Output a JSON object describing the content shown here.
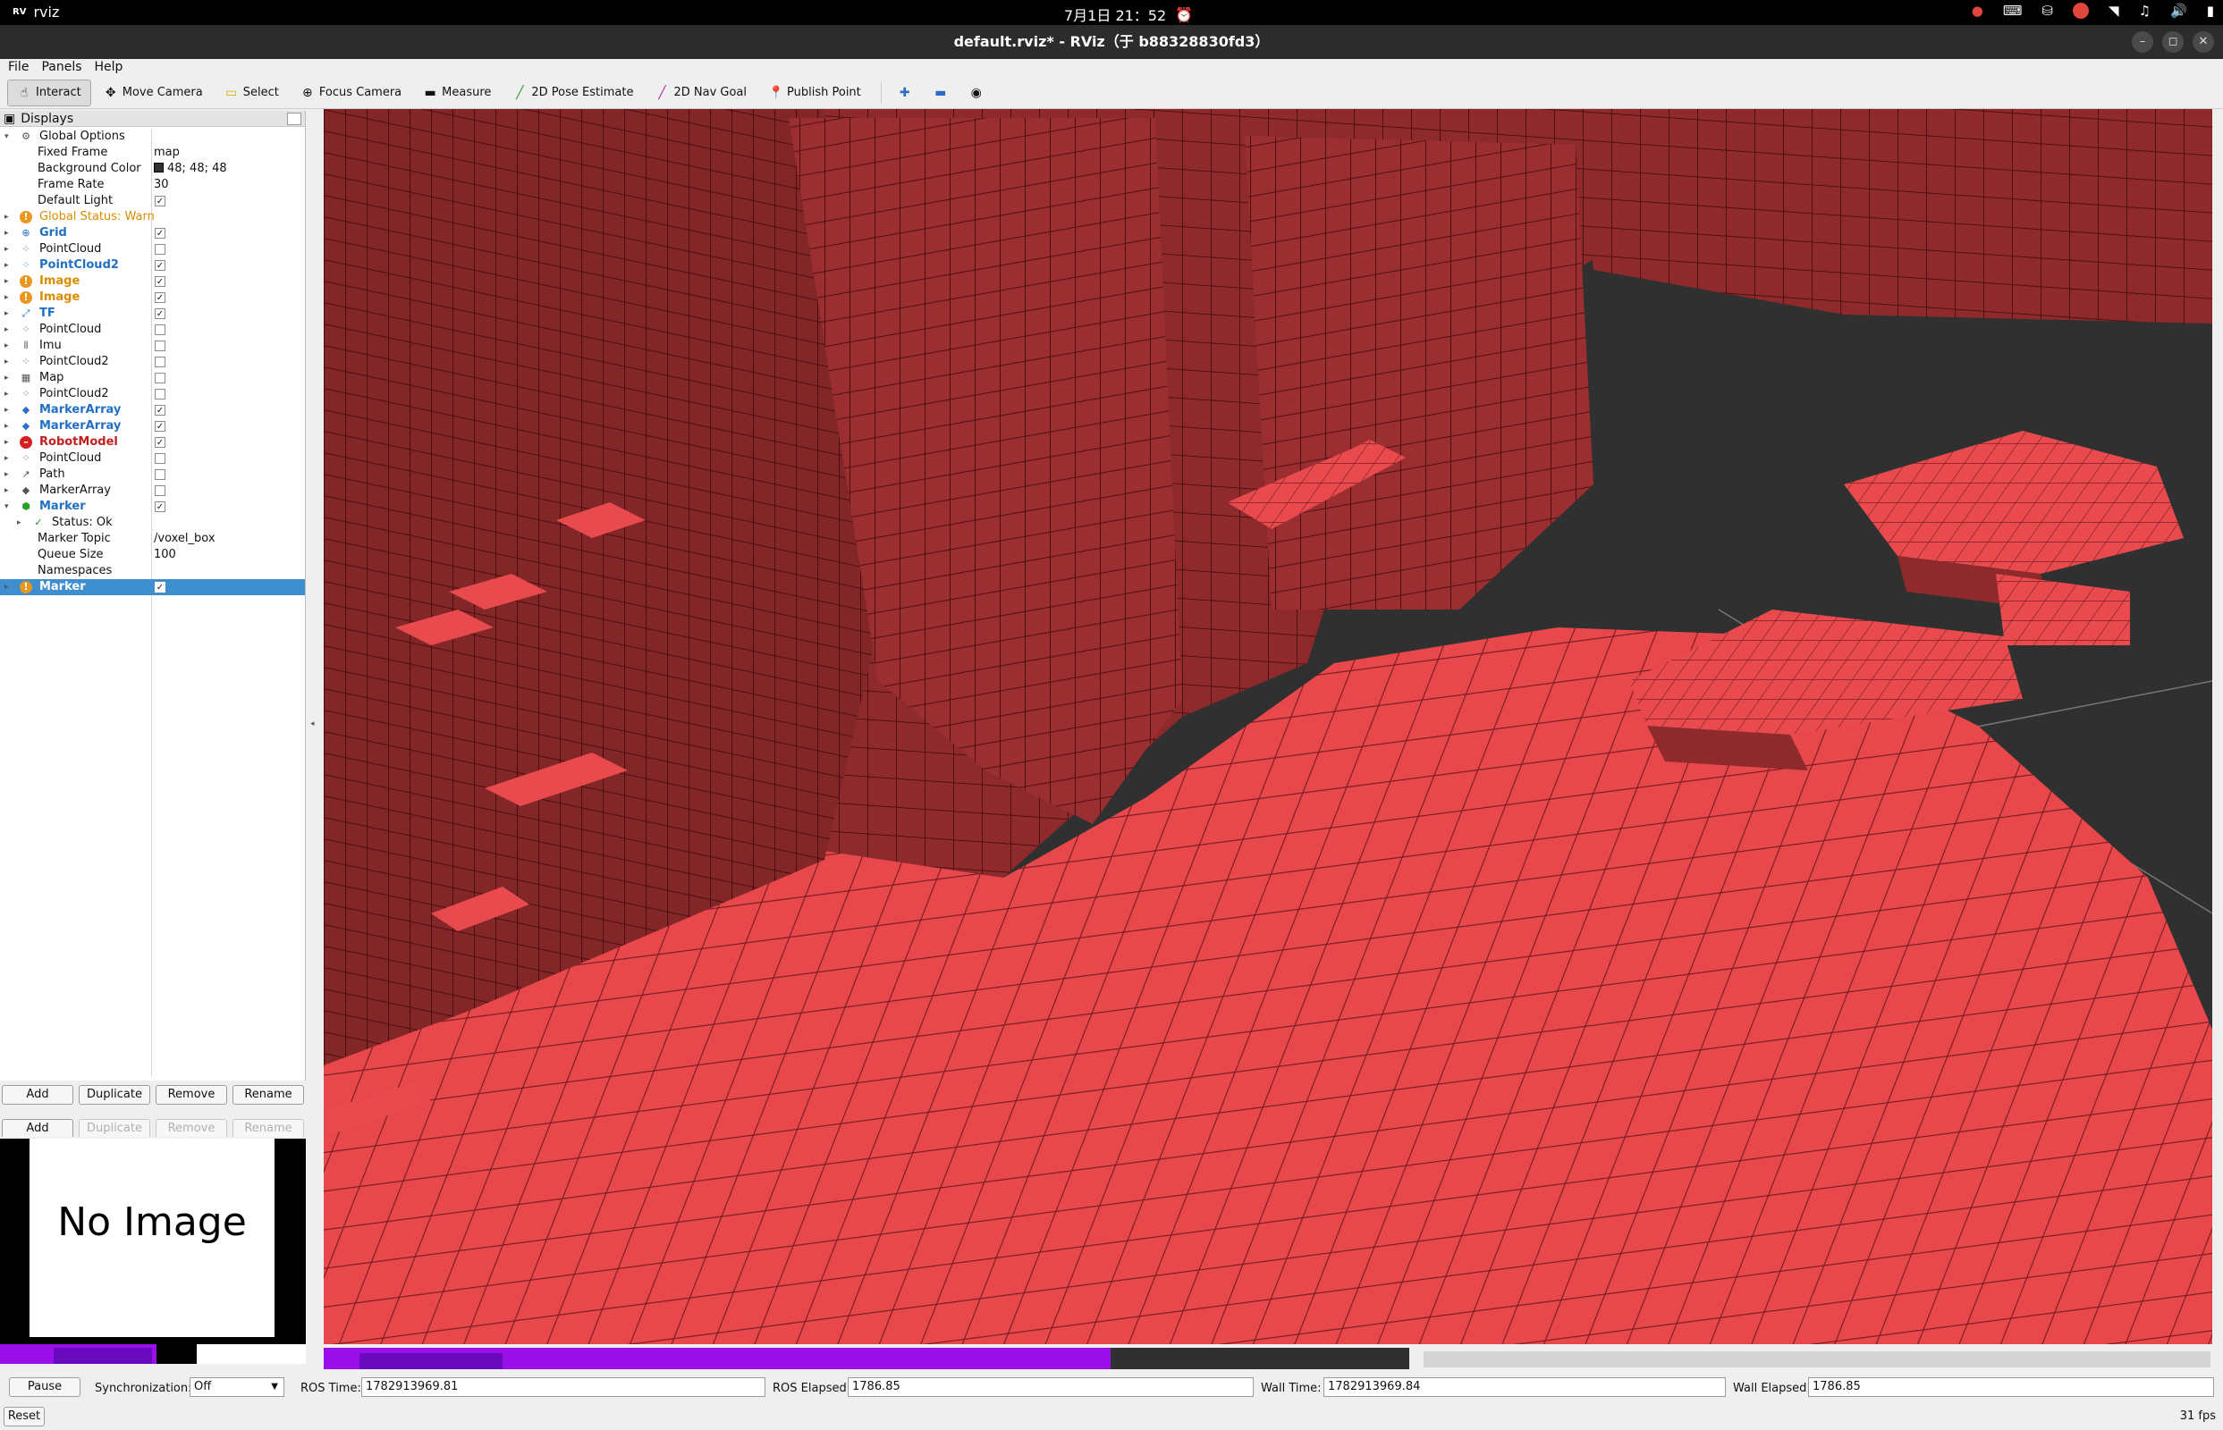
{
  "topbar": {
    "app_name": "rviz",
    "app_badge": "RV",
    "datetime": "7月1日  21：52",
    "tray_icons": [
      "record-icon",
      "keyboard-icon",
      "network-icon",
      "shield-icon",
      "wifi-icon",
      "mic-icon",
      "volume-icon",
      "battery-icon"
    ]
  },
  "window": {
    "title": "default.rviz* - RViz（于 b88328830fd3）"
  },
  "menu": [
    "File",
    "Panels",
    "Help"
  ],
  "toolbar": {
    "tools": [
      {
        "label": "Interact",
        "icon": "hand-icon",
        "active": true
      },
      {
        "label": "Move Camera",
        "icon": "move-camera-icon"
      },
      {
        "label": "Select",
        "icon": "select-icon"
      },
      {
        "label": "Focus Camera",
        "icon": "focus-camera-icon"
      },
      {
        "label": "Measure",
        "icon": "ruler-icon"
      },
      {
        "label": "2D Pose Estimate",
        "icon": "pose-arrow-icon"
      },
      {
        "label": "2D Nav Goal",
        "icon": "nav-goal-icon"
      },
      {
        "label": "Publish Point",
        "icon": "map-pin-icon"
      }
    ]
  },
  "displays": {
    "title": "Displays",
    "rows": [
      {
        "indent": 0,
        "arrow": "▾",
        "icon": "⚙",
        "name": "Global Options",
        "style": ""
      },
      {
        "indent": 1,
        "name": "Fixed Frame",
        "value": "map"
      },
      {
        "indent": 1,
        "name": "Background Color",
        "value": "48; 48; 48",
        "swatch": true
      },
      {
        "indent": 1,
        "name": "Frame Rate",
        "value": "30"
      },
      {
        "indent": 1,
        "name": "Default Light",
        "check": true
      },
      {
        "indent": 0,
        "arrow": "▸",
        "icon": "!",
        "iconclass": "warn-ico",
        "name": "Global Status: Warn",
        "style": "orange-plain"
      },
      {
        "indent": 0,
        "arrow": "▸",
        "icon": "⊕",
        "name": "Grid",
        "style": "blue",
        "check": true
      },
      {
        "indent": 0,
        "arrow": "▸",
        "icon": "⁘",
        "name": "PointCloud",
        "style": "",
        "check": false
      },
      {
        "indent": 0,
        "arrow": "▸",
        "icon": "⁘",
        "name": "PointCloud2",
        "style": "blue",
        "check": true
      },
      {
        "indent": 0,
        "arrow": "▸",
        "icon": "!",
        "iconclass": "warn-ico",
        "name": "Image",
        "style": "orange",
        "check": true
      },
      {
        "indent": 0,
        "arrow": "▸",
        "icon": "!",
        "iconclass": "warn-ico",
        "name": "Image",
        "style": "orange",
        "check": true
      },
      {
        "indent": 0,
        "arrow": "▸",
        "icon": "⤢",
        "name": "TF",
        "style": "blue",
        "check": true
      },
      {
        "indent": 0,
        "arrow": "▸",
        "icon": "⁘",
        "name": "PointCloud",
        "style": "",
        "check": false
      },
      {
        "indent": 0,
        "arrow": "▸",
        "icon": "⫴",
        "name": "Imu",
        "style": "",
        "check": false
      },
      {
        "indent": 0,
        "arrow": "▸",
        "icon": "⁘",
        "name": "PointCloud2",
        "style": "",
        "check": false
      },
      {
        "indent": 0,
        "arrow": "▸",
        "icon": "▦",
        "name": "Map",
        "style": "",
        "check": false
      },
      {
        "indent": 0,
        "arrow": "▸",
        "icon": "⁘",
        "name": "PointCloud2",
        "style": "",
        "check": false
      },
      {
        "indent": 0,
        "arrow": "▸",
        "icon": "◆",
        "name": "MarkerArray",
        "style": "blue",
        "check": true
      },
      {
        "indent": 0,
        "arrow": "▸",
        "icon": "◆",
        "name": "MarkerArray",
        "style": "blue",
        "check": true
      },
      {
        "indent": 0,
        "arrow": "▸",
        "icon": "–",
        "iconclass": "err-ico",
        "name": "RobotModel",
        "style": "red",
        "check": true
      },
      {
        "indent": 0,
        "arrow": "▸",
        "icon": "⁘",
        "name": "PointCloud",
        "style": "",
        "check": false
      },
      {
        "indent": 0,
        "arrow": "▸",
        "icon": "↗",
        "name": "Path",
        "style": "",
        "check": false
      },
      {
        "indent": 0,
        "arrow": "▸",
        "icon": "◆",
        "name": "MarkerArray",
        "style": "",
        "check": false
      },
      {
        "indent": 0,
        "arrow": "▾",
        "icon": "⬢",
        "name": "Marker",
        "style": "blue",
        "check": true
      },
      {
        "indent": 1,
        "arrow": "▸",
        "icon": "✓",
        "name": "Status: Ok",
        "style": "sub"
      },
      {
        "indent": 1,
        "name": "Marker Topic",
        "value": "/voxel_box"
      },
      {
        "indent": 1,
        "name": "Queue Size",
        "value": "100"
      },
      {
        "indent": 1,
        "name": "Namespaces",
        "value": ""
      },
      {
        "indent": 0,
        "arrow": "▸",
        "icon": "!",
        "iconclass": "warn-ico",
        "name": "Marker",
        "style": "selected",
        "check": true
      }
    ],
    "buttons": [
      "Add",
      "Duplicate",
      "Remove",
      "Rename"
    ]
  },
  "image_panel": {
    "text": "No Image"
  },
  "timebar": {
    "pause": "Pause",
    "sync_label": "Synchronization:",
    "sync_value": "Off",
    "ros_time_label": "ROS Time:",
    "ros_time": "1782913969.81",
    "ros_elapsed_label": "ROS Elapsed:",
    "ros_elapsed": "1786.85",
    "wall_time_label": "Wall Time:",
    "wall_time": "1782913969.84",
    "wall_elapsed_label": "Wall Elapsed:",
    "wall_elapsed": "1786.85"
  },
  "status": {
    "reset": "Reset",
    "fps": "31 fps"
  },
  "colors": {
    "voxel_top": "#e8474c",
    "voxel_side": "#8e2a2c",
    "voxel_edge": "#5a1416",
    "background": "#303030"
  }
}
